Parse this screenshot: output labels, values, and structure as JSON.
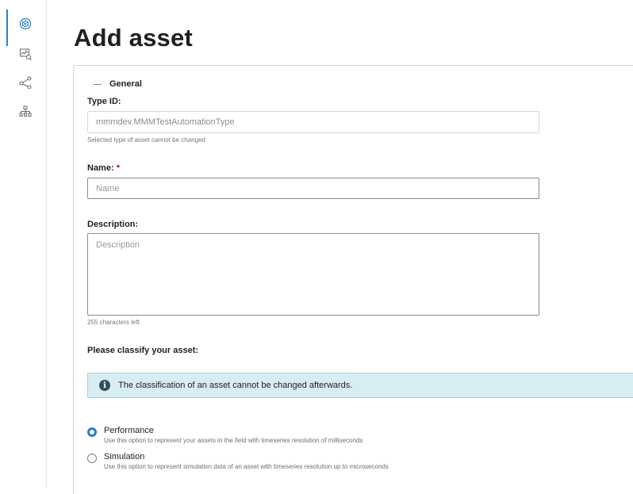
{
  "sidebar": {
    "items": [
      {
        "icon": "asset-manager-icon",
        "active": true
      },
      {
        "icon": "monitor-chart-icon",
        "active": false
      },
      {
        "icon": "share-icon",
        "active": false
      },
      {
        "icon": "hierarchy-icon",
        "active": false
      }
    ],
    "accent": "#2d7fc1"
  },
  "page": {
    "title": "Add asset"
  },
  "general_section": {
    "toggle_label": "General"
  },
  "type_id": {
    "label": "Type ID:",
    "value": "mmmdev.MMMTestAutomationType",
    "hint": "Selected type of asset cannot be changed"
  },
  "name_field": {
    "label": "Name:",
    "required_mark": "*",
    "placeholder": "Name"
  },
  "description_field": {
    "label": "Description:",
    "placeholder": "Description",
    "chars_left": "255 characters left"
  },
  "classification": {
    "prompt": "Please classify your asset:",
    "info_text": "The classification of an asset cannot be changed afterwards.",
    "info_icon": "info-icon",
    "options": [
      {
        "label": "Performance",
        "description": "Use this option to represent your assets in the field with timeseries resolution of milliseconds",
        "selected": true
      },
      {
        "label": "Simulation",
        "description": "Use this option to represent simulation data of an asset with timeseries resolution up to microseconds",
        "selected": false
      }
    ]
  }
}
